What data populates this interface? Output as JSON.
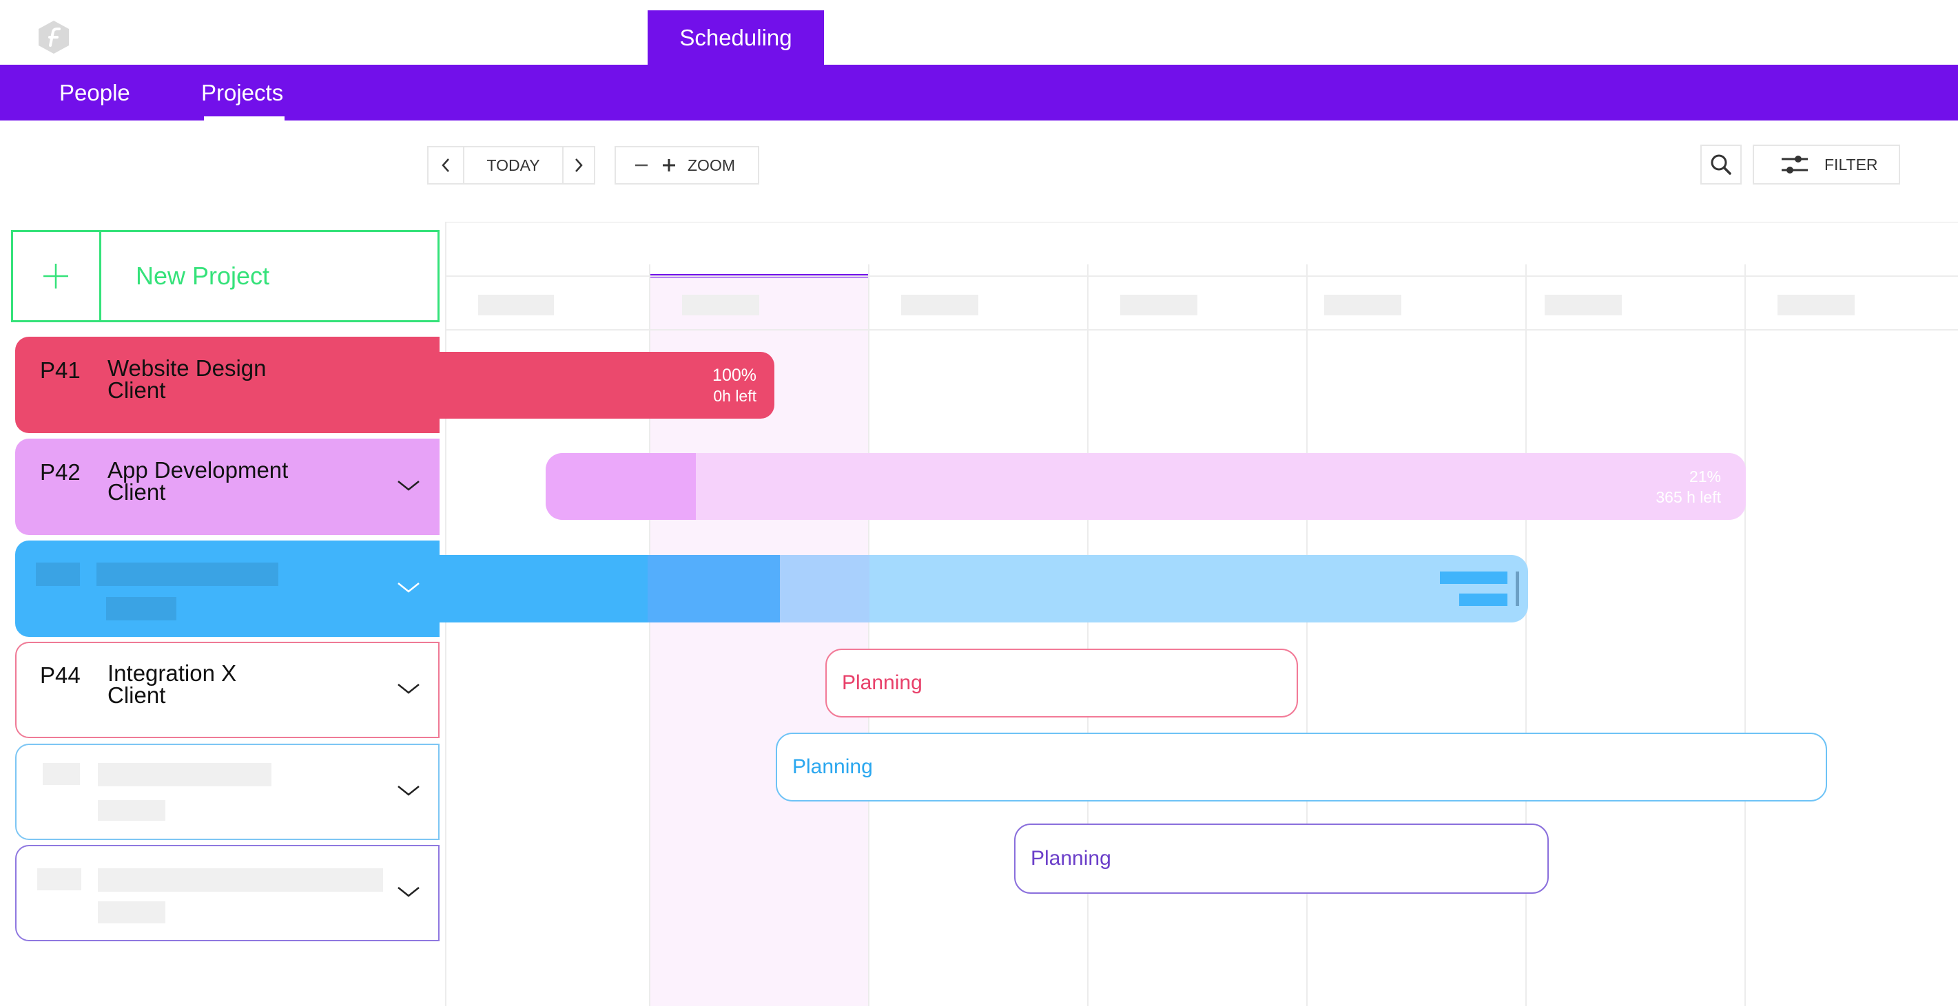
{
  "header": {
    "app_tab": "Scheduling",
    "nav": [
      "People",
      "Projects"
    ],
    "active_nav": "Projects"
  },
  "toolbar": {
    "today": "TODAY",
    "zoom": "ZOOM",
    "filter": "FILTER"
  },
  "sidebar": {
    "new_project": "New Project",
    "projects": [
      {
        "code": "P41",
        "name": "Website Design",
        "client": "Client",
        "color": "#eb496d"
      },
      {
        "code": "P42",
        "name": "App Development",
        "client": "Client",
        "color": "#e7a2f7"
      },
      {
        "code": "",
        "name": "",
        "client": "",
        "color": "#40b4fb"
      },
      {
        "code": "P44",
        "name": "Integration X",
        "client": "Client",
        "color": "#eb496d"
      },
      {
        "code": "",
        "name": "",
        "client": "",
        "color": "#5bb8f5"
      },
      {
        "code": "",
        "name": "",
        "client": "",
        "color": "#7a5ae0"
      }
    ]
  },
  "timeline": {
    "bars": [
      {
        "project": "P41",
        "percent": "100%",
        "left": "0h left",
        "progress": 1.0
      },
      {
        "project": "P42",
        "percent": "21%",
        "left": "365 h left",
        "progress": 0.21
      }
    ],
    "planning": [
      {
        "label": "Planning",
        "color": "#e8406a"
      },
      {
        "label": "Planning",
        "color": "#2aa7ef"
      },
      {
        "label": "Planning",
        "color": "#6b3fc9"
      }
    ]
  },
  "colors": {
    "brand": "#7210ea",
    "accent_green": "#35e27a"
  }
}
